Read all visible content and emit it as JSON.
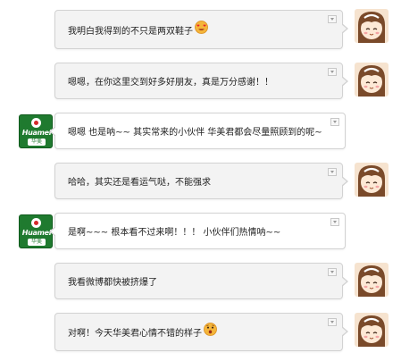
{
  "brand": {
    "logo_text": "Huamei",
    "logo_cn": "华美"
  },
  "messages": [
    {
      "side": "right",
      "text": "我明白我得到的不只是两双鞋子",
      "emoji": "heart-eyes-emoji"
    },
    {
      "side": "right",
      "text": "嗯嗯，在你这里交到好多好朋友，真是万分感谢！！"
    },
    {
      "side": "left",
      "text": "嗯嗯 也是呐~~ 其实常来的小伙伴 华美君都会尽量照顾到的呢~"
    },
    {
      "side": "right",
      "text": "哈哈，其实还是看运气哒，不能强求"
    },
    {
      "side": "left",
      "text": "是啊~~~ 根本看不过来啊！！！ 小伙伴们热情呐~~"
    },
    {
      "side": "right",
      "text": "我看微博都快被挤爆了"
    },
    {
      "side": "right",
      "text": "对啊！今天华美君心情不错的样子",
      "emoji": "surprised-emoji"
    }
  ]
}
